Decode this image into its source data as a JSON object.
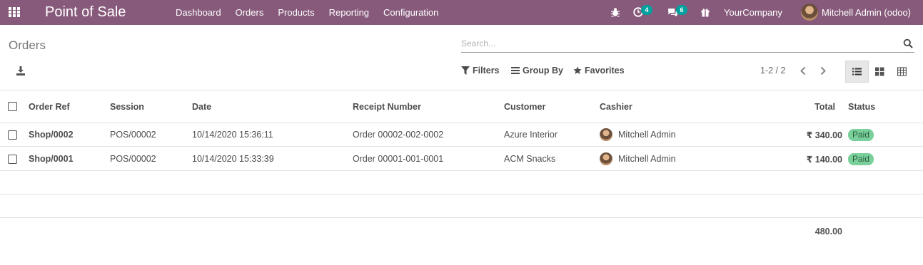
{
  "navbar": {
    "app_title": "Point of Sale",
    "menu": [
      "Dashboard",
      "Orders",
      "Products",
      "Reporting",
      "Configuration"
    ],
    "activity_count": "4",
    "message_count": "6",
    "company": "YourCompany",
    "user": "Mitchell Admin (odoo)",
    "color": "#875a7b"
  },
  "control_panel": {
    "title": "Orders",
    "search_placeholder": "Search...",
    "filters_label": "Filters",
    "groupby_label": "Group By",
    "favorites_label": "Favorites",
    "pager": "1-2 / 2"
  },
  "table": {
    "columns": [
      "Order Ref",
      "Session",
      "Date",
      "Receipt Number",
      "Customer",
      "Cashier",
      "Total",
      "Status"
    ],
    "rows": [
      {
        "order_ref": "Shop/0002",
        "session": "POS/00002",
        "date": "10/14/2020 15:36:11",
        "receipt": "Order 00002-002-0002",
        "customer": "Azure Interior",
        "cashier": "Mitchell Admin",
        "total": "₹ 340.00",
        "status": "Paid"
      },
      {
        "order_ref": "Shop/0001",
        "session": "POS/00002",
        "date": "10/14/2020 15:33:39",
        "receipt": "Order 00001-001-0001",
        "customer": "ACM Snacks",
        "cashier": "Mitchell Admin",
        "total": "₹ 140.00",
        "status": "Paid"
      }
    ],
    "sum_total": "480.00"
  }
}
